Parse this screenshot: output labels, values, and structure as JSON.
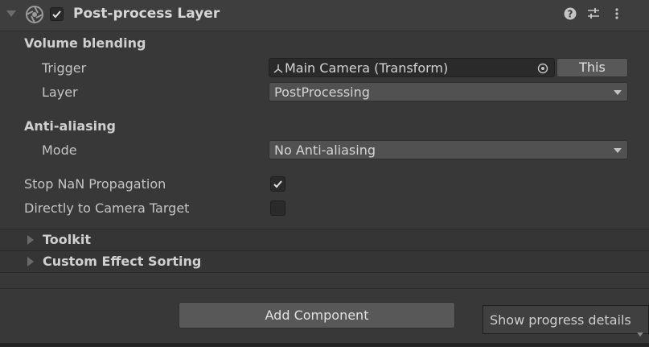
{
  "component": {
    "title": "Post-process Layer",
    "enabled": true,
    "icons": [
      "help-icon",
      "preset-icon",
      "more-icon"
    ]
  },
  "volume_blending": {
    "heading": "Volume blending",
    "trigger_label": "Trigger",
    "trigger_value": "Main Camera (Transform)",
    "this_button": "This",
    "layer_label": "Layer",
    "layer_value": "PostProcessing"
  },
  "anti_aliasing": {
    "heading": "Anti-aliasing",
    "mode_label": "Mode",
    "mode_value": "No Anti-aliasing"
  },
  "options": {
    "stop_nan_label": "Stop NaN Propagation",
    "stop_nan_checked": true,
    "direct_camera_label": "Directly to Camera Target",
    "direct_camera_checked": false
  },
  "foldouts": {
    "toolkit": "Toolkit",
    "custom_effect_sorting": "Custom Effect Sorting"
  },
  "add_component_button": "Add Component",
  "tooltip": "Show progress details",
  "colors": {
    "background": "#383838",
    "header": "#3e3e3e",
    "field": "#2a2a2a",
    "dropdown": "#515151"
  }
}
